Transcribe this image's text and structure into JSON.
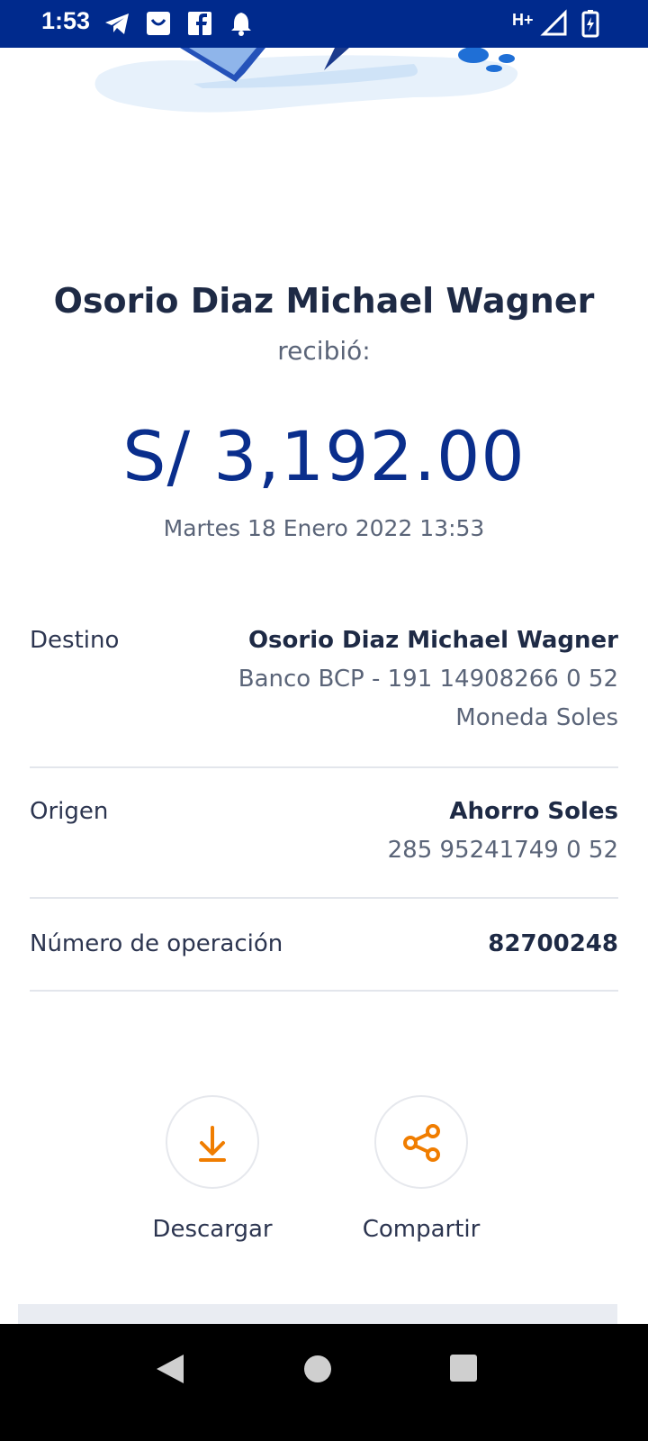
{
  "status_bar": {
    "time": "1:53",
    "icons": [
      "telegram-icon",
      "shopping-bag-icon",
      "facebook-icon",
      "notification-bell-icon",
      "network-type-icon",
      "signal-icon",
      "battery-charging-icon"
    ],
    "network_label": "H+"
  },
  "receipt": {
    "recipient_name": "Osorio Diaz Michael Wagner",
    "received_label": "recibió:",
    "amount": "S/ 3,192.00",
    "date": "Martes 18 Enero 2022 13:53"
  },
  "details": {
    "destination": {
      "label": "Destino",
      "name": "Osorio Diaz Michael Wagner",
      "bank_account": "Banco BCP - 191 14908266 0 52",
      "currency": "Moneda Soles"
    },
    "origin": {
      "label": "Origen",
      "account_type": "Ahorro Soles",
      "account_number": "285 95241749 0 52"
    },
    "operation": {
      "label": "Número de operación",
      "number": "82700248"
    }
  },
  "actions": {
    "download_label": "Descargar",
    "share_label": "Compartir"
  },
  "colors": {
    "status_bar": "#002a8d",
    "amount": "#0a2e8c",
    "accent_icon": "#f07d00",
    "text_dark": "#1e2a45",
    "text_muted": "#5a6478"
  }
}
